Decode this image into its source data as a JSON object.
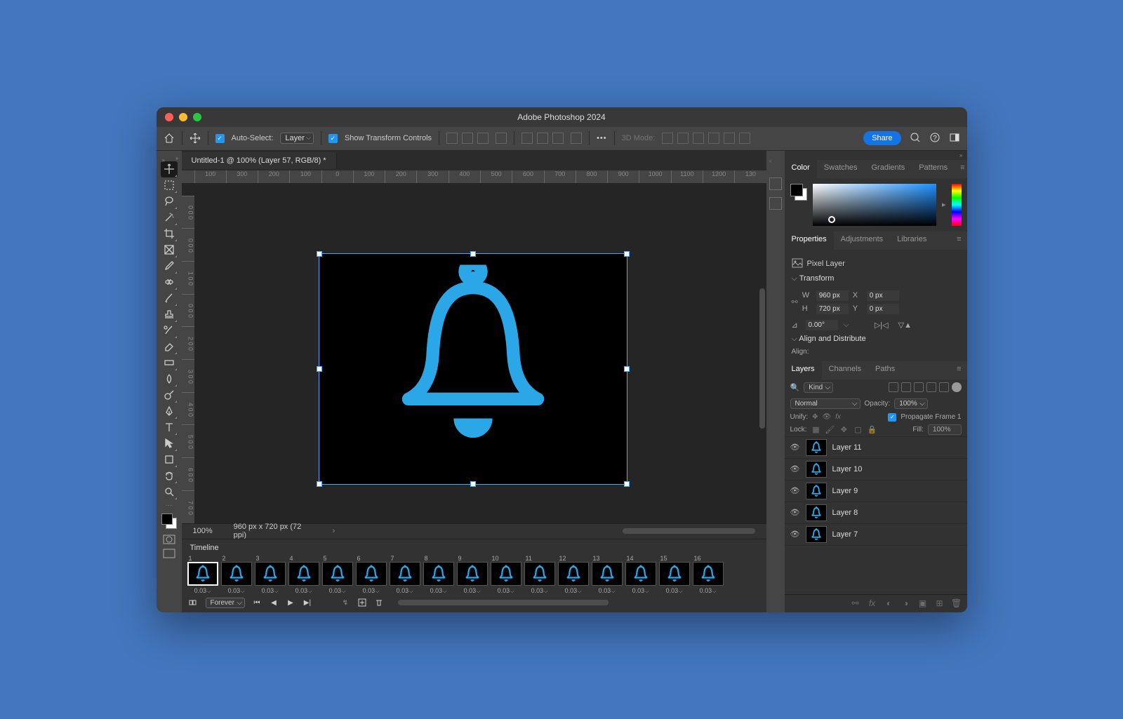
{
  "title": "Adobe Photoshop 2024",
  "options": {
    "auto_select_label": "Auto-Select:",
    "auto_select_value": "Layer",
    "show_transform_label": "Show Transform Controls",
    "mode_label": "3D Mode:",
    "share": "Share"
  },
  "doc_tab": "Untitled-1 @ 100% (Layer 57, RGB/8) *",
  "ruler_h": [
    "100",
    "300",
    "200",
    "100",
    "0",
    "100",
    "200",
    "300",
    "400",
    "500",
    "600",
    "700",
    "800",
    "900",
    "1000",
    "1100",
    "1200",
    "130"
  ],
  "ruler_v": [
    "0",
    "0",
    "1",
    "0",
    "2",
    "3",
    "4",
    "5",
    "6",
    "7"
  ],
  "status": {
    "zoom": "100%",
    "dims": "960 px x 720 px (72 ppi)"
  },
  "timeline": {
    "label": "Timeline",
    "frames": [
      {
        "n": "1",
        "t": "0.03"
      },
      {
        "n": "2",
        "t": "0.03"
      },
      {
        "n": "3",
        "t": "0.03"
      },
      {
        "n": "4",
        "t": "0.03"
      },
      {
        "n": "5",
        "t": "0.03"
      },
      {
        "n": "6",
        "t": "0.03"
      },
      {
        "n": "7",
        "t": "0.03"
      },
      {
        "n": "8",
        "t": "0.03"
      },
      {
        "n": "9",
        "t": "0.03"
      },
      {
        "n": "10",
        "t": "0.03"
      },
      {
        "n": "11",
        "t": "0.03"
      },
      {
        "n": "12",
        "t": "0.03"
      },
      {
        "n": "13",
        "t": "0.03"
      },
      {
        "n": "14",
        "t": "0.03"
      },
      {
        "n": "15",
        "t": "0.03"
      },
      {
        "n": "16",
        "t": "0.03"
      }
    ],
    "loop": "Forever"
  },
  "panels": {
    "color_tabs": [
      "Color",
      "Swatches",
      "Gradients",
      "Patterns"
    ],
    "prop_tabs": [
      "Properties",
      "Adjustments",
      "Libraries"
    ],
    "layer_tabs": [
      "Layers",
      "Channels",
      "Paths"
    ],
    "layer_type": "Pixel Layer",
    "transform_label": "Transform",
    "w_label": "W",
    "w_value": "960 px",
    "h_label": "H",
    "h_value": "720 px",
    "x_label": "X",
    "x_value": "0 px",
    "y_label": "Y",
    "y_value": "0 px",
    "angle_label": "⊿",
    "angle_value": "0.00°",
    "align_label": "Align and Distribute",
    "align_sub": "Align:",
    "kind_label": "Kind",
    "blend_mode": "Normal",
    "opacity_label": "Opacity:",
    "opacity_value": "100%",
    "unify_label": "Unify:",
    "propagate_label": "Propagate Frame 1",
    "lock_label": "Lock:",
    "fill_label": "Fill:",
    "fill_value": "100%",
    "layers": [
      {
        "name": "Layer 11"
      },
      {
        "name": "Layer 10"
      },
      {
        "name": "Layer 9"
      },
      {
        "name": "Layer 8"
      },
      {
        "name": "Layer 7"
      }
    ]
  },
  "colors": {
    "bell": "#2ba7e8"
  }
}
